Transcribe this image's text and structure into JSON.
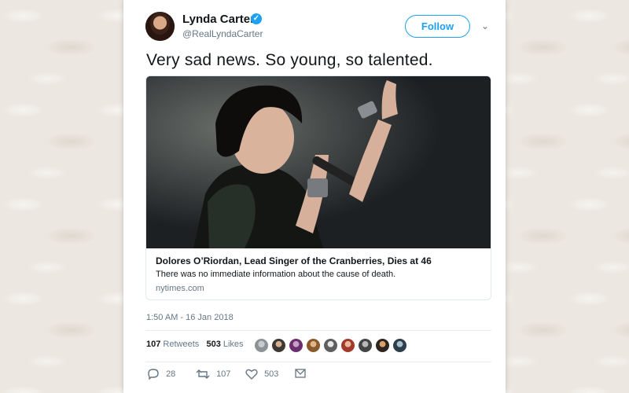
{
  "user": {
    "name": "Lynda Carter",
    "handle": "@RealLyndaCarter",
    "verified_icon": "verified-badge-icon",
    "follow_label": "Follow"
  },
  "tweet": {
    "text": "Very sad news. So young, so talented.",
    "timestamp": "1:50 AM - 16 Jan 2018"
  },
  "link_card": {
    "title": "Dolores O’Riordan, Lead Singer of the Cranberries, Dies at 46",
    "description": "There was no immediate information about the cause of death.",
    "domain": "nytimes.com"
  },
  "stats": {
    "retweets_count": "107",
    "retweets_label": "Retweets",
    "likes_count": "503",
    "likes_label": "Likes"
  },
  "actions": {
    "reply_count": "28",
    "retweet_count": "107",
    "like_count": "503"
  },
  "colors": {
    "accent": "#1da1f2",
    "text": "#14171a",
    "muted": "#657786"
  }
}
